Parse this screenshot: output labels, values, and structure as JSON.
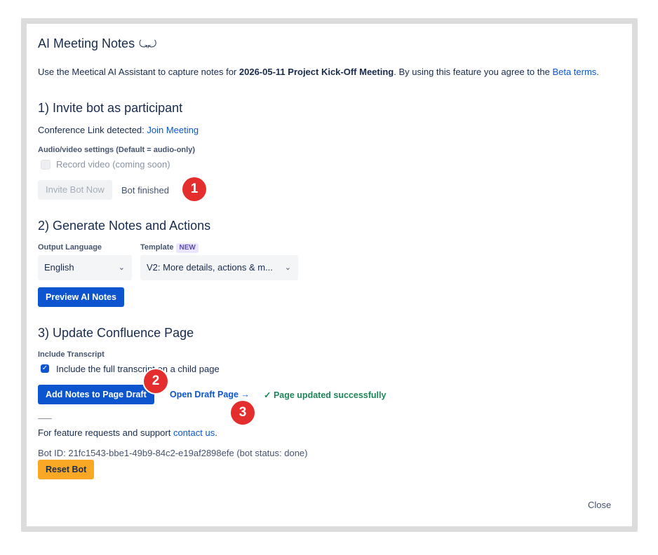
{
  "header": {
    "title": "AI Meeting Notes",
    "title_icon": "⤿⤾",
    "intro_prefix": "Use the Meetical AI Assistant to capture notes for ",
    "meeting_name": "2026-05-11 Project Kick-Off Meeting",
    "intro_middle": ". By using this feature you agree to the ",
    "beta_link": "Beta terms",
    "intro_suffix": "."
  },
  "section1": {
    "heading": "1) Invite bot as participant",
    "conference_label": "Conference Link detected: ",
    "join_link": "Join Meeting",
    "av_label": "Audio/video settings (Default = audio-only)",
    "record_video_label": "Record video (coming soon)",
    "invite_button": "Invite Bot Now",
    "bot_status": "Bot finished"
  },
  "section2": {
    "heading": "2) Generate Notes and Actions",
    "output_language_label": "Output Language",
    "output_language_value": "English",
    "template_label": "Template",
    "template_badge": "NEW",
    "template_value": "V2: More details, actions & m...",
    "preview_button": "Preview AI Notes"
  },
  "section3": {
    "heading": "3) Update Confluence Page",
    "include_transcript_label": "Include Transcript",
    "include_transcript_checkbox_label": "Include the full transcript on a child page",
    "add_notes_button": "Add Notes to Page Draft",
    "open_draft_link": "Open Draft Page →",
    "success_message": "✓ Page updated successfully"
  },
  "footer": {
    "support_prefix": "For feature requests and support ",
    "contact_link": "contact us",
    "support_suffix": ".",
    "bot_id_text": "Bot ID: 21fc1543-bbe1-49b9-84c2-e19af2898efe (bot status: done)",
    "reset_button": "Reset Bot",
    "close_button": "Close"
  },
  "annotations": {
    "badge1": "1",
    "badge2": "2",
    "badge3": "3"
  },
  "colors": {
    "primary": "#0c55cf",
    "success": "#1f845a",
    "warning": "#f9a825",
    "annotation": "#e42d2d"
  },
  "icons": {
    "chevron": "⌄",
    "check": "✓"
  }
}
